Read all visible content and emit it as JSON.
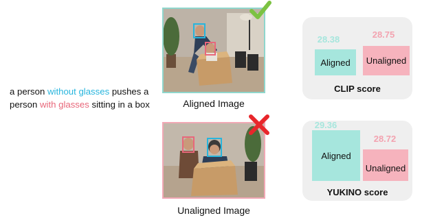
{
  "caption": {
    "p1": "a person ",
    "p2": "without glasses",
    "p3": " pushes a person ",
    "p4": "with glasses",
    "p5": " sitting in a box"
  },
  "images": {
    "aligned_label": "Aligned Image",
    "unaligned_label": "Unaligned Image",
    "aligned_mark": "check-icon",
    "unaligned_mark": "cross-icon"
  },
  "panels": [
    {
      "title": "CLIP score",
      "aligned_label": "Aligned",
      "unaligned_label": "Unaligned",
      "aligned_score": "28.38",
      "unaligned_score": "28.75"
    },
    {
      "title": "YUKINO score",
      "aligned_label": "Aligned",
      "unaligned_label": "Unaligned",
      "aligned_score": "29.36",
      "unaligned_score": "28.72"
    }
  ],
  "colors": {
    "aligned": "#a6e6dd",
    "unaligned": "#f6b3bd",
    "text_without_glasses": "#27b5dd",
    "text_with_glasses": "#e8677a",
    "check": "#7cc242",
    "cross": "#e8262b"
  }
}
